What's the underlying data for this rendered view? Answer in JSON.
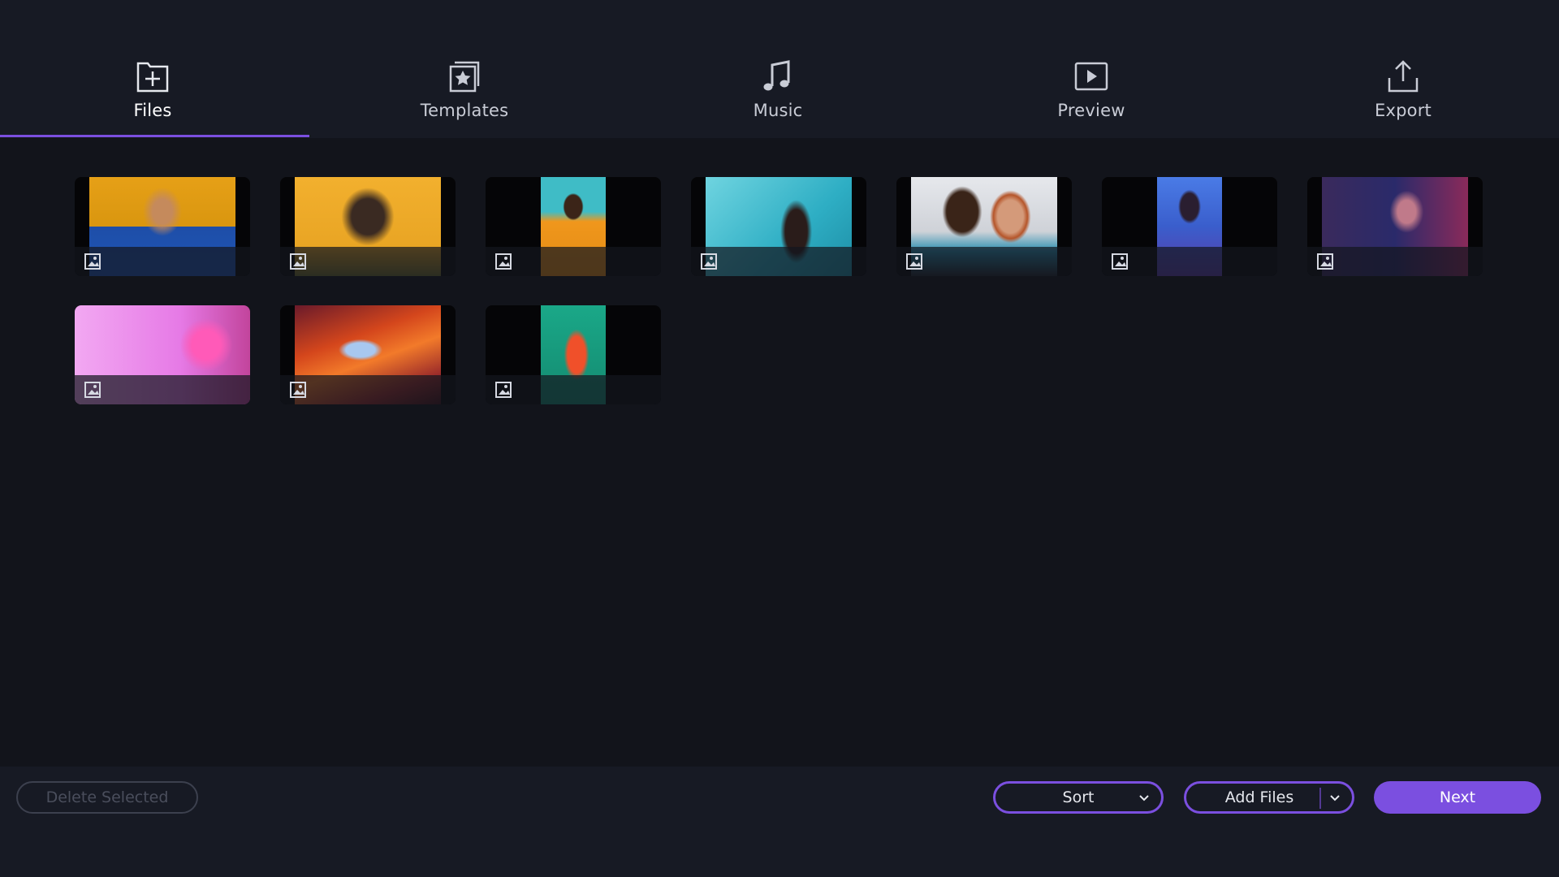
{
  "nav": {
    "tabs": [
      {
        "label": "Files",
        "icon": "folder-plus-icon",
        "active": true
      },
      {
        "label": "Templates",
        "icon": "templates-star-icon",
        "active": false
      },
      {
        "label": "Music",
        "icon": "music-note-icon",
        "active": false
      },
      {
        "label": "Preview",
        "icon": "play-preview-icon",
        "active": false
      },
      {
        "label": "Export",
        "icon": "export-upload-icon",
        "active": false
      }
    ]
  },
  "media": {
    "items": [
      {
        "type": "image",
        "icon": "image-file-icon"
      },
      {
        "type": "image",
        "icon": "image-file-icon"
      },
      {
        "type": "image",
        "icon": "image-file-icon"
      },
      {
        "type": "image",
        "icon": "image-file-icon"
      },
      {
        "type": "image",
        "icon": "image-file-icon"
      },
      {
        "type": "image",
        "icon": "image-file-icon"
      },
      {
        "type": "image",
        "icon": "image-file-icon"
      },
      {
        "type": "image",
        "icon": "image-file-icon"
      },
      {
        "type": "image",
        "icon": "image-file-icon"
      },
      {
        "type": "image",
        "icon": "image-file-icon"
      }
    ]
  },
  "footer": {
    "delete_label": "Delete Selected",
    "sort_label": "Sort",
    "add_files_label": "Add Files",
    "next_label": "Next"
  },
  "colors": {
    "accent": "#7b4fe0",
    "background": "#12141b",
    "panel": "#171a24"
  }
}
